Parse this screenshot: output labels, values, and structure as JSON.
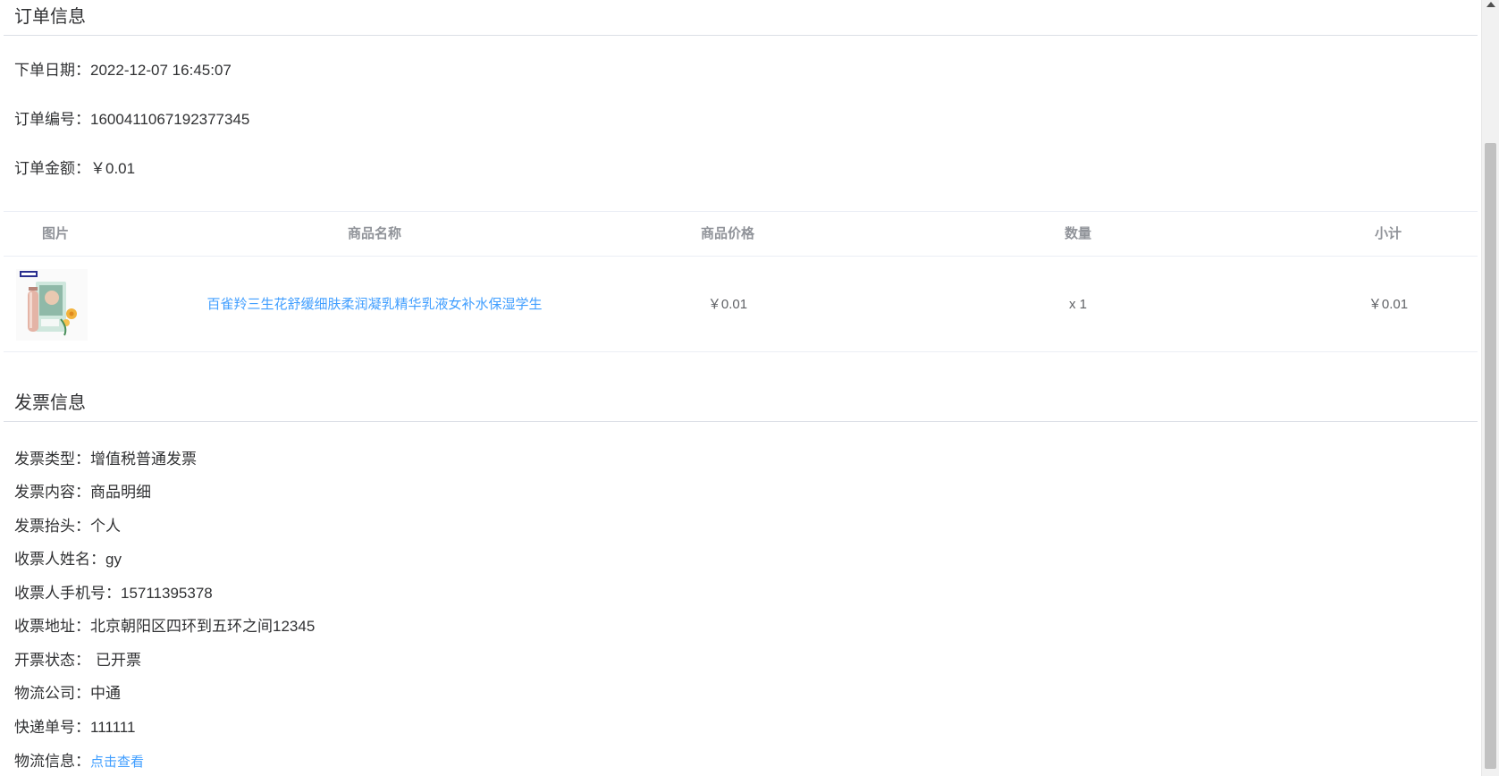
{
  "order_info": {
    "title": "订单信息",
    "fields": [
      {
        "label": "下单日期：",
        "value": "2022-12-07 16:45:07"
      },
      {
        "label": "订单编号：",
        "value": "1600411067192377345"
      },
      {
        "label": "订单金额：",
        "value": "￥0.01"
      }
    ]
  },
  "table": {
    "headers": [
      "图片",
      "商品名称",
      "商品价格",
      "数量",
      "小计"
    ],
    "rows": [
      {
        "image_alt": "product-thumbnail",
        "name": "百雀羚三生花舒缓细肤柔润凝乳精华乳液女补水保湿学生",
        "price": "￥0.01",
        "quantity": "x 1",
        "subtotal": "￥0.01"
      }
    ]
  },
  "invoice_info": {
    "title": "发票信息",
    "fields": [
      {
        "label": "发票类型：",
        "value": "增值税普通发票"
      },
      {
        "label": "发票内容：",
        "value": "商品明细"
      },
      {
        "label": "发票抬头：",
        "value": "个人"
      },
      {
        "label": "收票人姓名：",
        "value": "gy"
      },
      {
        "label": "收票人手机号：",
        "value": "15711395378"
      },
      {
        "label": "收票地址：",
        "value": "北京朝阳区四环到五环之间12345"
      },
      {
        "label": "开票状态：",
        "value": "已开票",
        "color": "#67c23a"
      },
      {
        "label": "物流公司：",
        "value": "中通"
      },
      {
        "label": "快递单号：",
        "value": "111111"
      },
      {
        "label": "物流信息：",
        "value": "点击查看",
        "link_color": "#409eff"
      }
    ]
  },
  "colors": {
    "link": "#409eff",
    "success": "#67c23a",
    "text": "#303133",
    "header_text": "#909399"
  }
}
